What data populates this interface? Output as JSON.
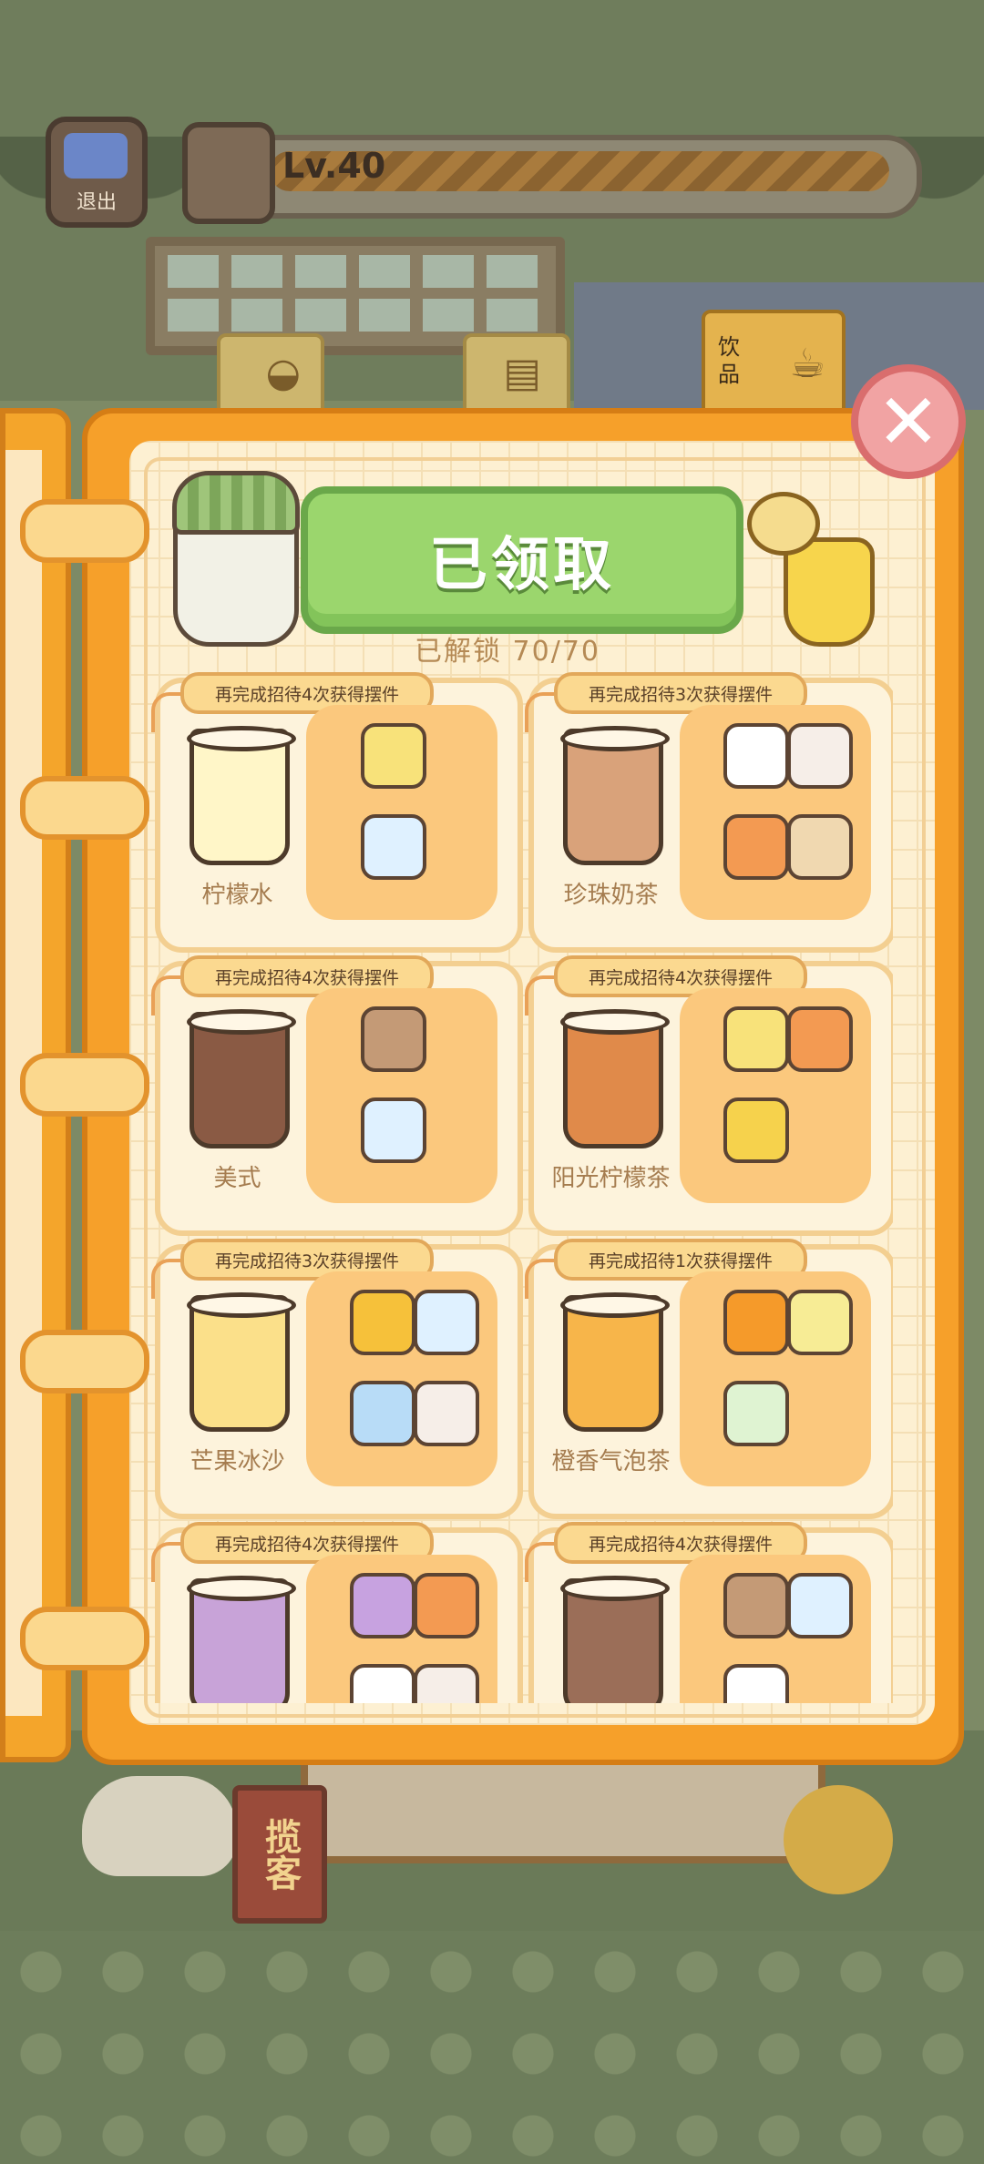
{
  "hud": {
    "back_label": "退出",
    "level_label": "Lv.40",
    "level_progress": 1.0
  },
  "tabs": [
    {
      "label": "",
      "icon": "bread-icon"
    },
    {
      "label": "",
      "icon": "clipboard-icon"
    },
    {
      "label": "饮\n品",
      "icon": "drink-icon",
      "active": true
    }
  ],
  "book": {
    "claim_label": "已领取",
    "unlock_text": "已解锁  70/70",
    "close_glyph": "✕"
  },
  "drinks": [
    {
      "banner": "再完成招待4次获得摆件",
      "name": "柠檬水",
      "cup_color": "#fff6c8",
      "parts": [
        {
          "icon": "lemon-slice-icon",
          "color": "#f8e27a"
        },
        {
          "icon": "water-bottle-icon",
          "color": "#dff1ff"
        }
      ]
    },
    {
      "banner": "再完成招待3次获得摆件",
      "name": "珍珠奶茶",
      "cup_color": "#d9a27a",
      "parts": [
        {
          "icon": "milk-jug-icon",
          "color": "#ffffff"
        },
        {
          "icon": "sugar-jar-icon",
          "color": "#f6eee8"
        },
        {
          "icon": "tea-jar-icon",
          "color": "#f39a52"
        },
        {
          "icon": "tapioca-jar-icon",
          "color": "#f0d8b0"
        }
      ]
    },
    {
      "banner": "再完成招待4次获得摆件",
      "name": "美式",
      "cup_color": "#8a5a44",
      "parts": [
        {
          "icon": "coffee-beans-icon",
          "color": "#c49a76"
        },
        {
          "icon": "water-bottle-icon",
          "color": "#dff1ff"
        }
      ]
    },
    {
      "banner": "再完成招待4次获得摆件",
      "name": "阳光柠檬茶",
      "cup_color": "#e08a4a",
      "parts": [
        {
          "icon": "lemon-slice-icon",
          "color": "#f8e27a"
        },
        {
          "icon": "tea-jar-icon",
          "color": "#f39a52"
        },
        {
          "icon": "honey-jar-icon",
          "color": "#f6d24c"
        }
      ]
    },
    {
      "banner": "再完成招待3次获得摆件",
      "name": "芒果冰沙",
      "cup_color": "#fbe08a",
      "parts": [
        {
          "icon": "mango-icon",
          "color": "#f6c13a"
        },
        {
          "icon": "water-bottle-icon",
          "color": "#dff1ff"
        },
        {
          "icon": "ice-cubes-icon",
          "color": "#b8dcf7"
        },
        {
          "icon": "sugar-jar-icon",
          "color": "#f6eee8"
        }
      ]
    },
    {
      "banner": "再完成招待1次获得摆件",
      "name": "橙香气泡茶",
      "cup_color": "#f7b54a",
      "parts": [
        {
          "icon": "orange-slice-icon",
          "color": "#f59a2a"
        },
        {
          "icon": "jasmine-tea-icon",
          "color": "#f7ec95"
        },
        {
          "icon": "soda-bottle-icon",
          "color": "#dff3d2"
        }
      ]
    },
    {
      "banner": "再完成招待4次获得摆件",
      "name": "",
      "cup_color": "#c8a3d8",
      "parts": [
        {
          "icon": "taro-icon",
          "color": "#c7a2e0"
        },
        {
          "icon": "tea-jar-icon",
          "color": "#f39a52"
        },
        {
          "icon": "milk-jug-icon",
          "color": "#ffffff"
        },
        {
          "icon": "sugar-jar-icon",
          "color": "#f6eee8"
        }
      ]
    },
    {
      "banner": "再完成招待4次获得摆件",
      "name": "",
      "cup_color": "#9b6e58",
      "parts": [
        {
          "icon": "coffee-beans-icon",
          "color": "#c49a76"
        },
        {
          "icon": "water-bottle-icon",
          "color": "#dff1ff"
        },
        {
          "icon": "milk-jug-icon",
          "color": "#ffffff"
        }
      ]
    }
  ],
  "background": {
    "shop_sign_text": "",
    "lanyard_text": "揽客"
  }
}
